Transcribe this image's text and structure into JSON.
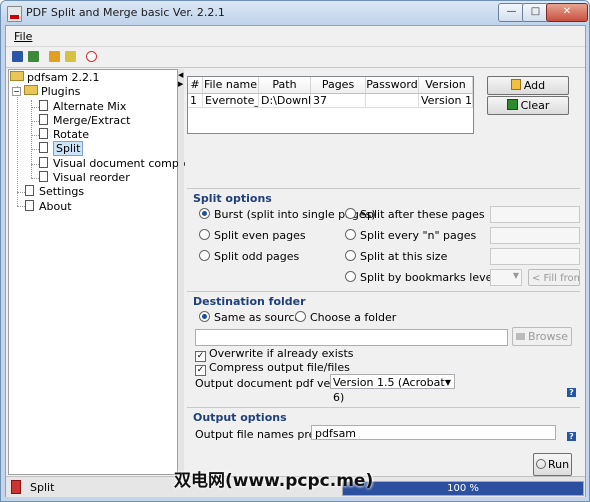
{
  "window": {
    "title": "PDF Split and Merge basic Ver. 2.2.1",
    "min_glyph": "—",
    "max_glyph": "□",
    "close_glyph": "✕"
  },
  "menu": {
    "file": "File"
  },
  "tree": {
    "root": "pdfsam 2.2.1",
    "plugins_label": "Plugins",
    "plugins": [
      "Alternate Mix",
      "Merge/Extract",
      "Rotate",
      "Split",
      "Visual document composer",
      "Visual reorder"
    ],
    "selected": "Split",
    "settings": "Settings",
    "about": "About"
  },
  "file_table": {
    "columns": [
      "#",
      "File name",
      "Path",
      "Pages",
      "Password",
      "Version"
    ],
    "rows": [
      [
        "1",
        "Evernote_...",
        "D:\\Downl...",
        "37",
        "",
        "Version 1...."
      ]
    ]
  },
  "buttons": {
    "add": "Add",
    "clear": "Clear",
    "browse": "Browse",
    "run": "Run"
  },
  "split_options": {
    "title": "Split options",
    "burst": "Burst (split into single pages)",
    "even": "Split even pages",
    "odd": "Split odd pages",
    "after": "Split after these pages",
    "every_n": "Split every \"n\" pages",
    "size": "Split at this size",
    "bookmarks": "Split by bookmarks level",
    "fill_from": "< Fill from",
    "selected": "burst"
  },
  "destination": {
    "title": "Destination folder",
    "same_as_source": "Same as source",
    "choose_folder": "Choose a folder",
    "overwrite": "Overwrite if already exists",
    "compress": "Compress output file/files",
    "pdf_version_label": "Output document pdf version:",
    "pdf_version_value": "Version 1.5 (Acrobat 6)",
    "help_glyph": "?"
  },
  "output": {
    "title": "Output options",
    "prefix_label": "Output file names prefix:",
    "prefix_value": "pdfsam"
  },
  "status": {
    "text": "Split",
    "progress_text": "100 %",
    "progress": 1.0
  },
  "watermark": "双电网(www.pcpc.me)",
  "colors": {
    "accent": "#1f3f7a",
    "progress": "#2c4fa0",
    "selection": "#cde3f8"
  }
}
